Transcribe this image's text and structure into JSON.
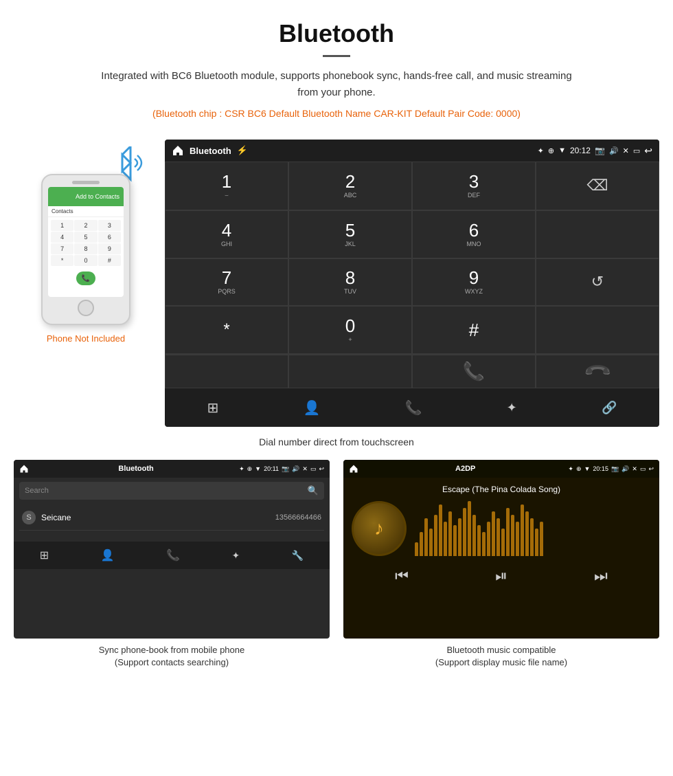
{
  "header": {
    "title": "Bluetooth",
    "description": "Integrated with BC6 Bluetooth module, supports phonebook sync, hands-free call, and music streaming from your phone.",
    "specs": "(Bluetooth chip : CSR BC6    Default Bluetooth Name CAR-KIT    Default Pair Code: 0000)"
  },
  "phone": {
    "not_included": "Phone Not Included",
    "screen_label": "Add to Contacts",
    "dial_keys": [
      "1",
      "2",
      "3",
      "4",
      "5",
      "6",
      "7",
      "8",
      "9",
      "*",
      "0+",
      "#"
    ]
  },
  "dial_screen": {
    "title": "Bluetooth",
    "time": "20:12",
    "keys": [
      {
        "num": "1",
        "sub": "⌣"
      },
      {
        "num": "2",
        "sub": "ABC"
      },
      {
        "num": "3",
        "sub": "DEF"
      },
      {
        "num": "4",
        "sub": "GHI"
      },
      {
        "num": "5",
        "sub": "JKL"
      },
      {
        "num": "6",
        "sub": "MNO"
      },
      {
        "num": "7",
        "sub": "PQRS"
      },
      {
        "num": "8",
        "sub": "TUV"
      },
      {
        "num": "9",
        "sub": "WXYZ"
      },
      {
        "num": "*",
        "sub": ""
      },
      {
        "num": "0",
        "sub": "+"
      },
      {
        "num": "#",
        "sub": ""
      }
    ],
    "caption": "Dial number direct from touchscreen"
  },
  "phonebook_screen": {
    "title": "Bluetooth",
    "time": "20:11",
    "search_placeholder": "Search",
    "contacts": [
      {
        "initial": "S",
        "name": "Seicane",
        "number": "13566664466"
      }
    ],
    "caption_line1": "Sync phone-book from mobile phone",
    "caption_line2": "(Support contacts searching)"
  },
  "music_screen": {
    "title": "A2DP",
    "time": "20:15",
    "song_title": "Escape (The Pina Colada Song)",
    "caption_line1": "Bluetooth music compatible",
    "caption_line2": "(Support display music file name)"
  },
  "visualizer_bars": [
    20,
    35,
    55,
    40,
    60,
    75,
    50,
    65,
    45,
    55,
    70,
    80,
    60,
    45,
    35,
    50,
    65,
    55,
    40,
    70,
    60,
    50,
    75,
    65,
    55,
    40,
    50
  ],
  "icons": {
    "house": "⌂",
    "bluetooth": "✦",
    "usb": "⚡",
    "location": "⊕",
    "wifi": "▼",
    "time_icon": "",
    "camera": "📷",
    "volume": "🔊",
    "close_x": "✕",
    "window": "▭",
    "back": "↩",
    "grid": "⊞",
    "person": "👤",
    "phone": "📞",
    "bt_icon": "✦",
    "link": "🔗",
    "search": "🔍",
    "call_green": "📞",
    "call_red": "📵",
    "refresh": "↺",
    "backspace": "⌫",
    "prev": "⏮",
    "playpause": "⏯",
    "next": "⏭",
    "person_small": "👤",
    "phone_small": "📞",
    "bt_small": "✦",
    "wrench": "🔧"
  }
}
